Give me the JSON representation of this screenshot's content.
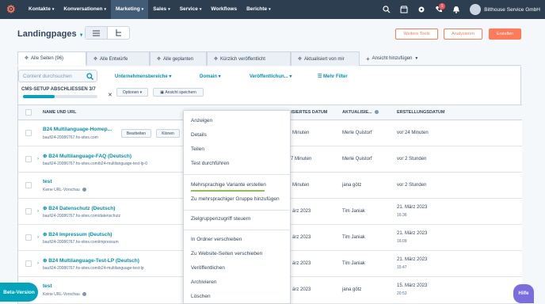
{
  "nav": {
    "items": [
      "Kontakte",
      "Konversationen",
      "Marketing",
      "Sales",
      "Service",
      "Workflows",
      "Berichte"
    ],
    "active": "Marketing",
    "notification_count": "1",
    "account": "Bilthouse Service GmbH",
    "icons": [
      "search-icon",
      "marketplace-icon",
      "settings-icon",
      "calling-icon",
      "bell-icon"
    ]
  },
  "header": {
    "title": "Landingpages",
    "buttons": {
      "tools": "Weitere Tools",
      "analyze": "Analysieren",
      "create": "Erstellen"
    }
  },
  "tabs": [
    {
      "label": "Alle Seiten (96)"
    },
    {
      "label": "Alle Entwürfe"
    },
    {
      "label": "Alle geplanten"
    },
    {
      "label": "Kürzlich veröffentlicht"
    },
    {
      "label": "Aktualisiert von mir"
    },
    {
      "label": "Ansicht hinzufügen"
    }
  ],
  "toolbar": {
    "search_placeholder": "Content durchsuchen",
    "filters": [
      "Unternehmensbereiche",
      "Domain",
      "Veröffentlichun...",
      "Mehr Filter"
    ],
    "cms_setup": "CMS-SETUP ABSCHLIESSEN 3/7",
    "progress": 0.43,
    "options": "Optionen",
    "save_view": "Ansicht speichern"
  },
  "table": {
    "headers": [
      "NAME UND URL",
      "ALISIERTES DATUM",
      "AKTUALISIE...",
      "ERSTELLUNGSDATUM"
    ],
    "rows": [
      {
        "name": "B24 Multilanguage-Homep...",
        "url": "baufi24-20086767.hs-sites.com",
        "updated": "Minuten",
        "by": "Merle Quistorf",
        "created": "vor 24 Minuten",
        "created_time": "",
        "buttons": [
          "Bearbeiten",
          "Klonen"
        ]
      },
      {
        "name": "B24 Multilanguage-FAQ (Deutsch)",
        "url": "baufi24-20086767.hs-sites.com/b24-multilanguage-test-lp-0",
        "updated": "7 Minuten",
        "by": "Merle Quistorf",
        "created": "vor 2 Stunden",
        "created_time": ""
      },
      {
        "name": "test",
        "url": "Keine URL-Vorschau",
        "updated": "Minuten",
        "by": "jana götz",
        "created": "vor 2 Stunden",
        "created_time": ""
      },
      {
        "name": "B24 Datenschutz (Deutsch)",
        "url": "baufi24-20086767.hs-sites.com/datenschutz",
        "updated": "ärz 2023",
        "by": "Tim Janiak",
        "created": "21. März 2023",
        "created_time": "16:36"
      },
      {
        "name": "B24 Impressum (Deutsch)",
        "url": "baufi24-20086767.hs-sites.com/impressum",
        "updated": "ärz 2023",
        "by": "Tim Janiak",
        "created": "21. März 2023",
        "created_time": "16:09"
      },
      {
        "name": "B24 Multilanguage-Test-LP (Deutsch)",
        "url": "baufi24-20086767.hs-sites.com/b24-multilanguage-test-lp",
        "updated": "ärz 2023",
        "by": "Tim Janiak",
        "created": "21. März 2023",
        "created_time": "15:47"
      },
      {
        "name": "test",
        "url": "Keine URL-Vorschau",
        "updated": "ärz 2023",
        "by": "jana götz",
        "created": "15. März 2023",
        "created_time": "20:53"
      }
    ]
  },
  "context_menu": {
    "items": [
      "Anzeigen",
      "Details",
      "Teilen",
      "Test durchführen",
      "Mehrsprachige Variante erstellen",
      "Zu mehrsprachiger Gruppe hinzufügen",
      "Zielgruppenzugriff steuern",
      "In Ordner verschieben",
      "Zu Website-Seiten verschieben",
      "Veröffentlichen",
      "Archivieren",
      "Löschen"
    ]
  },
  "floating": {
    "beta": "Beta-Version",
    "help": "Hilfe"
  },
  "colors": {
    "nav": "#2d3e50",
    "accent": "#ff7a59",
    "link": "#0091ae",
    "beta": "#00a4bd"
  }
}
